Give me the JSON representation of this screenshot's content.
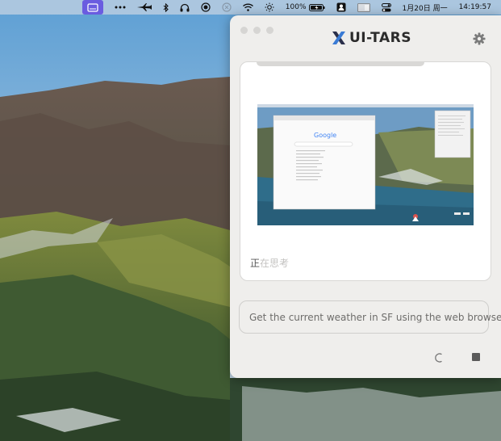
{
  "menubar": {
    "battery": "100%",
    "date": "1月20日 周一",
    "time": "14:19:57",
    "icons": [
      "app-window-icon",
      "more-dots-icon",
      "plane-icon",
      "bluetooth-icon",
      "headphones-icon",
      "record-icon",
      "gray-circle-icon",
      "wifi-icon",
      "brightness-icon",
      "battery-icon",
      "user-icon",
      "screen-icon",
      "control-center-icon"
    ]
  },
  "app": {
    "name": "UI-TARS",
    "status_text_first": "正",
    "status_text_rest": "在思考",
    "input_text": "Get the current weather in SF using the web browser",
    "screenshot_brand": "Google"
  },
  "colors": {
    "menu_active": "#6a5ce0",
    "logo_blue": "#3a7bd5",
    "panel_bg": "#efeeec"
  }
}
